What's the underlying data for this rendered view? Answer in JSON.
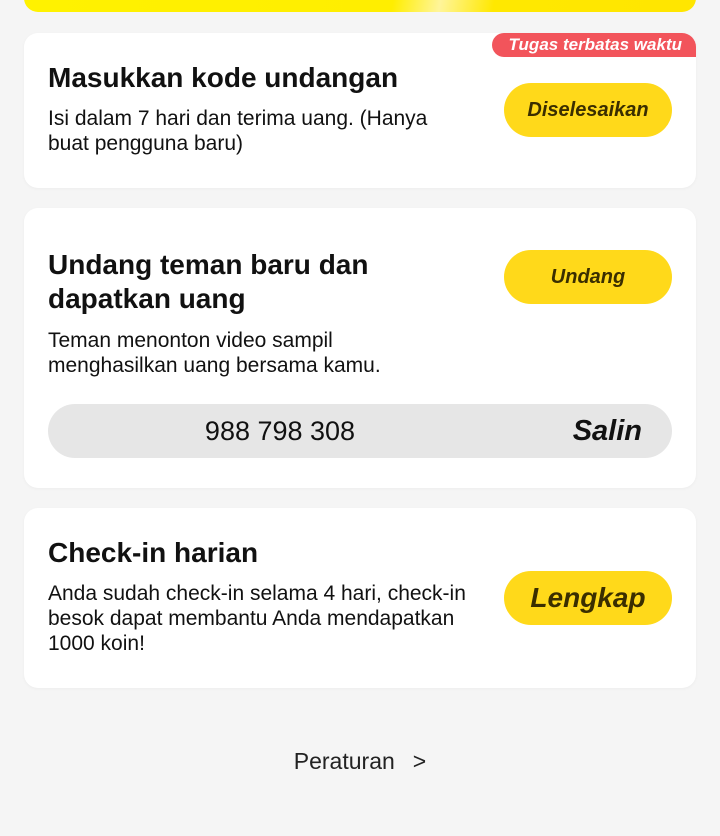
{
  "invite_code_task": {
    "badge": "Tugas terbatas waktu",
    "title": "Masukkan kode undangan",
    "description": "Isi dalam 7 hari dan terima uang. (Hanya buat pengguna baru)",
    "button_label": "Diselesaikan"
  },
  "invite_friends_task": {
    "title": "Undang teman baru dan dapatkan uang",
    "description": "Teman menonton video sampil menghasilkan uang bersama kamu.",
    "button_label": "Undang",
    "invite_code": "988 798 308",
    "copy_label": "Salin"
  },
  "daily_checkin_task": {
    "title": "Check-in harian",
    "description": "Anda sudah check-in selama 4 hari, check-in besok dapat membantu Anda mendapatkan 1000 koin!",
    "button_label": "Lengkap"
  },
  "footer": {
    "rules_label": "Peraturan",
    "rules_chevron": ">"
  },
  "colors": {
    "accent_yellow": "#ffd91a",
    "badge_red": "#f2545b",
    "page_background": "#f5f5f5"
  }
}
